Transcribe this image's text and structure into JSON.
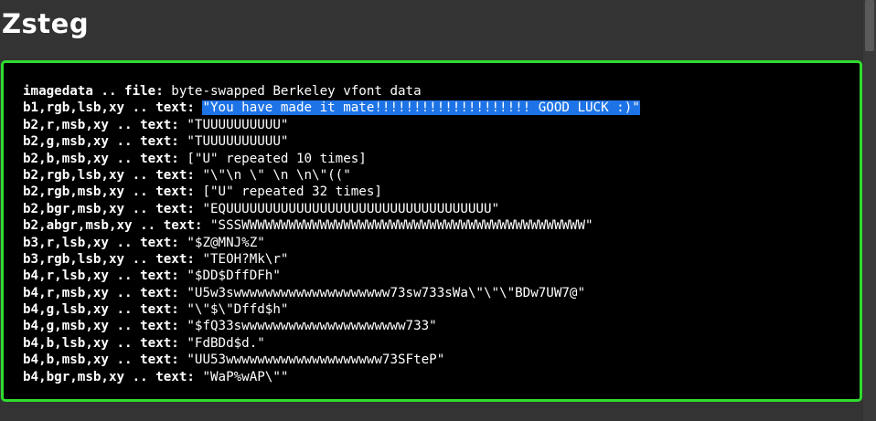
{
  "page": {
    "title": "Zsteg"
  },
  "terminal": {
    "lines": [
      {
        "key": "imagedata .. file:",
        "value": "byte-swapped Berkeley vfont data"
      },
      {
        "key": "b1,rgb,lsb,xy .. text:",
        "value": "\"You have made it mate!!!!!!!!!!!!!!!!!!!! GOOD LUCK :)\"",
        "highlighted": true
      },
      {
        "key": "b2,r,msb,xy .. text:",
        "value": "\"TUUUUUUUUUU\""
      },
      {
        "key": "b2,g,msb,xy .. text:",
        "value": "\"TUUUUUUUUUU\""
      },
      {
        "key": "b2,b,msb,xy .. text:",
        "value": "[\"U\" repeated 10 times]"
      },
      {
        "key": "b2,rgb,lsb,xy .. text:",
        "value": "\"\\\"\\n \\\" \\n \\n\\\"((\""
      },
      {
        "key": "b2,rgb,msb,xy .. text:",
        "value": "[\"U\" repeated 32 times]"
      },
      {
        "key": "b2,bgr,msb,xy .. text:",
        "value": "\"EQUUUUUUUUUUUUUUUUUUUUUUUUUUUUUUUUUU\""
      },
      {
        "key": "b2,abgr,msb,xy .. text:",
        "value": "\"SSSWWWWWWWWWWWWWWWWWWWWWWWWWWWWWWWWWWWWWWWWWWWW\""
      },
      {
        "key": "b3,r,lsb,xy .. text:",
        "value": "\"$Z@MNJ%Z\""
      },
      {
        "key": "b3,rgb,lsb,xy .. text:",
        "value": "\"TEOH?Mk\\r\""
      },
      {
        "key": "b4,r,lsb,xy .. text:",
        "value": "\"$DD$DffDFh\""
      },
      {
        "key": "b4,r,msb,xy .. text:",
        "value": "\"U5w3swwwwwwwwwwwwwwwwwwww73sw733sWa\\\"\\\"\\\"BDw7UW7@\""
      },
      {
        "key": "b4,g,lsb,xy .. text:",
        "value": "\"\\\"$\\\"Dffd$h\""
      },
      {
        "key": "b4,g,msb,xy .. text:",
        "value": "\"$fQ33swwwwwwwwwwwwwwwwwwwww733\""
      },
      {
        "key": "b4,b,lsb,xy .. text:",
        "value": "\"FdBDd$d.\""
      },
      {
        "key": "b4,b,msb,xy .. text:",
        "value": "\"UU53wwwwwwwwwwwwwwwwwwww73SFteP\""
      },
      {
        "key": "b4,bgr,msb,xy .. text:",
        "value": "\"WaP%wAP\\\"\""
      }
    ]
  },
  "colors": {
    "page_background": "#333333",
    "terminal_background": "#000000",
    "terminal_border": "#2fdc2f",
    "selection_highlight": "#1e73e6",
    "text": "#ffffff"
  }
}
